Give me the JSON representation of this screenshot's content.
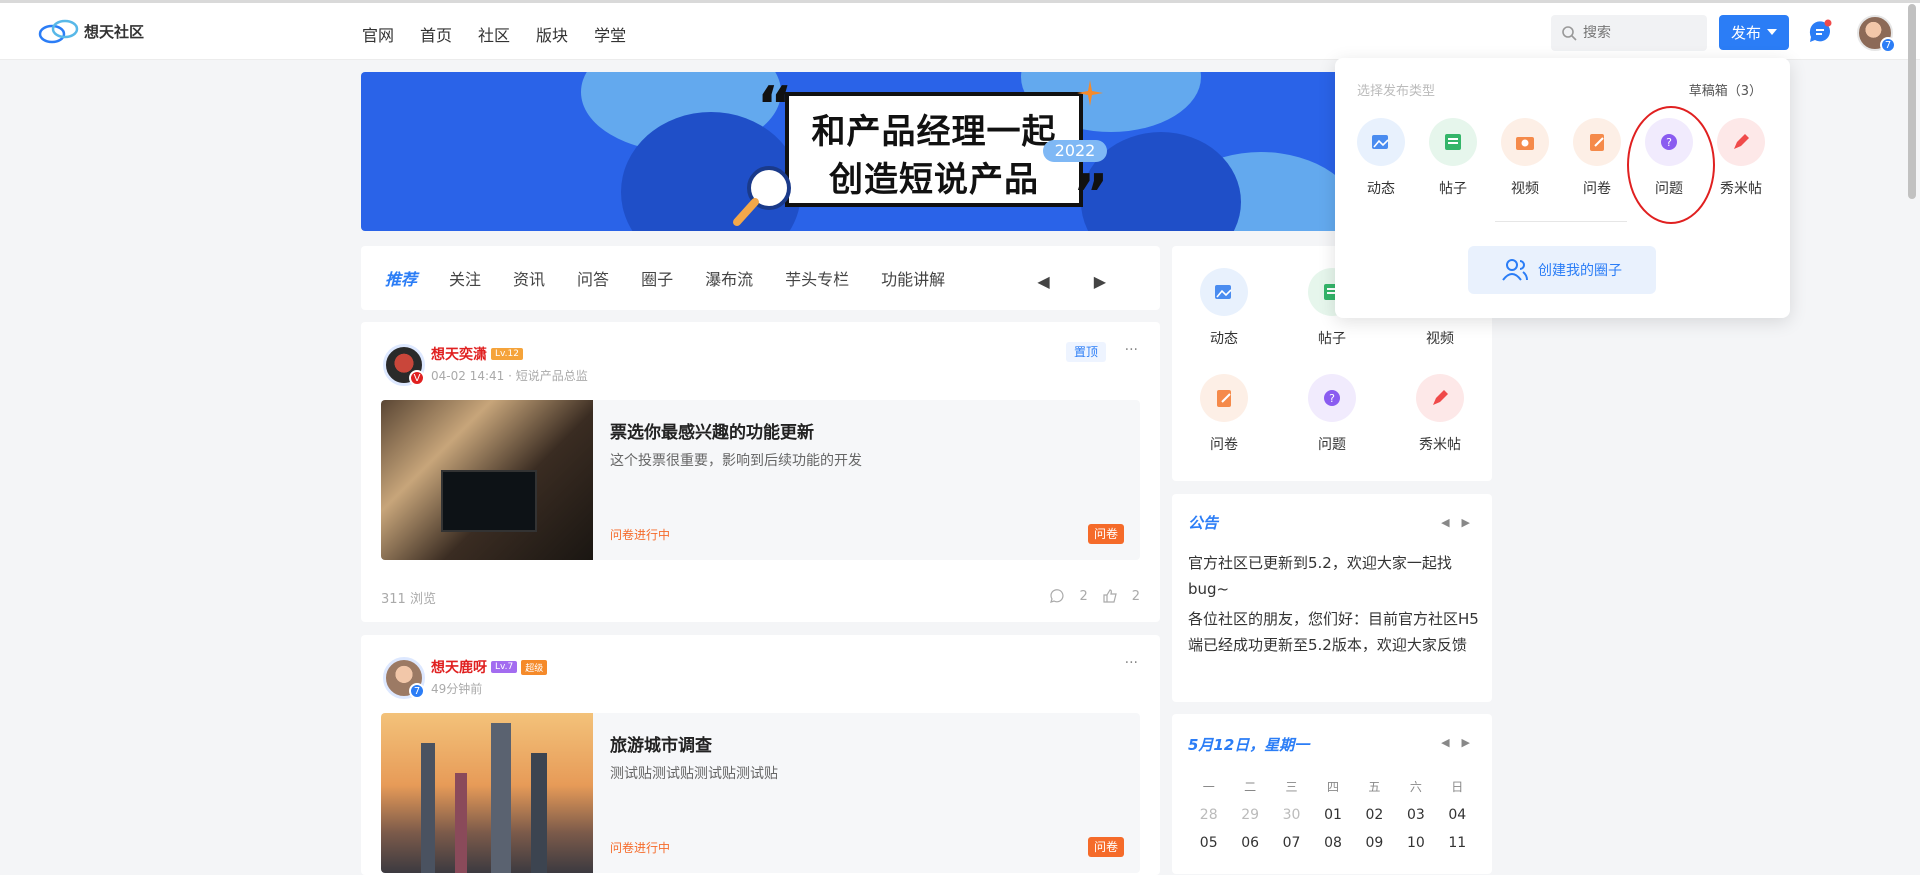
{
  "app": {
    "name": "想天社区"
  },
  "nav": [
    "官网",
    "首页",
    "社区",
    "版块",
    "学堂"
  ],
  "search": {
    "placeholder": "搜索"
  },
  "header": {
    "publish_label": "发布",
    "avatar_badge": "7"
  },
  "banner": {
    "line1": "和产品经理一起",
    "line2": "创造短说产品",
    "year": "2022"
  },
  "tabs": [
    "推荐",
    "关注",
    "资讯",
    "问答",
    "圈子",
    "瀑布流",
    "芋头专栏",
    "功能讲解"
  ],
  "posts": [
    {
      "author": "想天奕潇",
      "level": "Lv.12",
      "meta": "04-02 14:41 · 短说产品总监",
      "pinned_label": "置顶",
      "title": "票选你最感兴趣的功能更新",
      "desc": "这个投票很重要，影响到后续功能的开发",
      "status": "问卷进行中",
      "tag": "问卷",
      "views": "311 浏览",
      "comments": "2",
      "likes": "2"
    },
    {
      "author": "想天鹿呀",
      "level": "Lv.7",
      "extra_badge": "超级",
      "meta": "49分钟前",
      "avatar_badge": "7",
      "title": "旅游城市调查",
      "desc": "测试贴测试贴测试贴测试贴",
      "status": "问卷进行中",
      "tag": "问卷"
    }
  ],
  "side_types": [
    {
      "label": "动态",
      "icon": "image-edit-icon",
      "color": "#4a8cf0"
    },
    {
      "label": "帖子",
      "icon": "post-icon",
      "color": "#34b56a"
    },
    {
      "label": "视频",
      "icon": "camera-icon",
      "color": "#f58a4a"
    },
    {
      "label": "问卷",
      "icon": "survey-icon",
      "color": "#f58a4a"
    },
    {
      "label": "问题",
      "icon": "question-icon",
      "color": "#8a5cf0"
    },
    {
      "label": "秀米帖",
      "icon": "pen-icon",
      "color": "#f04a4a"
    }
  ],
  "announcement": {
    "title": "公告",
    "items": [
      "官方社区已更新到5.2，欢迎大家一起找bug~",
      "各位社区的朋友，您们好：目前官方社区H5端已经成功更新至5.2版本，欢迎大家反馈"
    ]
  },
  "calendar": {
    "title": "5月12日，星期一",
    "weekdays": [
      "一",
      "二",
      "三",
      "四",
      "五",
      "六",
      "日"
    ],
    "days": [
      "28",
      "29",
      "30",
      "01",
      "02",
      "03",
      "04",
      "05",
      "06",
      "07",
      "08",
      "09",
      "10",
      "11"
    ]
  },
  "popup": {
    "title": "选择发布类型",
    "draft": "草稿箱（3）",
    "types": [
      {
        "label": "动态",
        "icon": "image-edit-icon",
        "color": "#4a8cf0"
      },
      {
        "label": "帖子",
        "icon": "post-icon",
        "color": "#34b56a"
      },
      {
        "label": "视频",
        "icon": "camera-icon",
        "color": "#f58a4a"
      },
      {
        "label": "问卷",
        "icon": "survey-icon",
        "color": "#f58a4a"
      },
      {
        "label": "问题",
        "icon": "question-icon",
        "color": "#8a5cf0"
      },
      {
        "label": "秀米帖",
        "icon": "pen-icon",
        "color": "#f04a4a"
      }
    ],
    "create_circle": "创建我的圈子"
  },
  "colors": {
    "accent": "#2b7df6",
    "danger": "#e02020",
    "orange": "#f56b2a"
  }
}
